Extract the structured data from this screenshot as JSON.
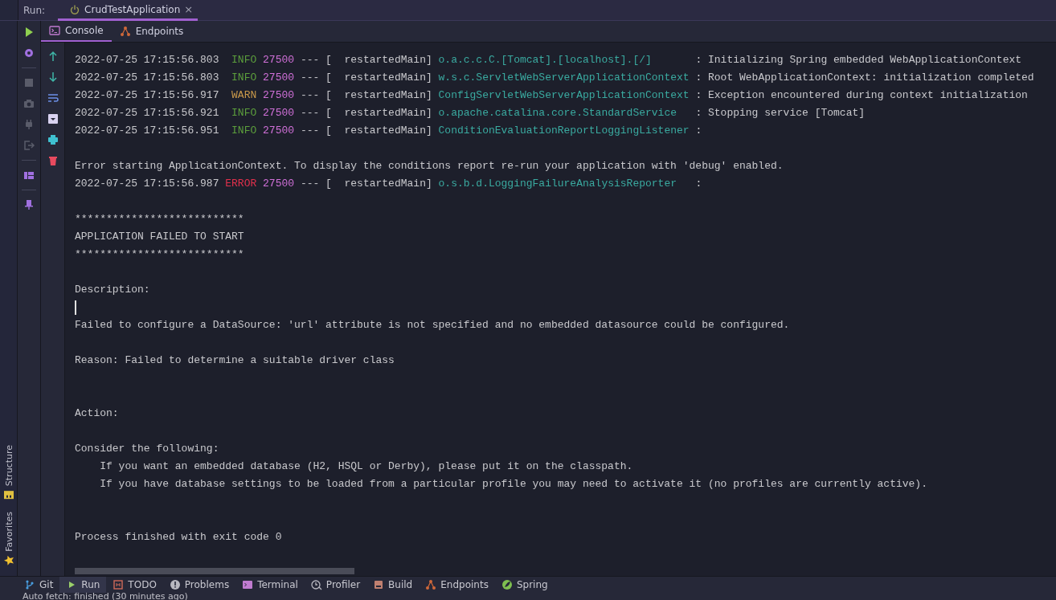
{
  "run_bar": {
    "label": "Run:",
    "tabs": [
      {
        "label": "CrudTestApplication",
        "selected": true,
        "close": "×"
      }
    ]
  },
  "console_tabs": [
    {
      "label": "Console",
      "kind": "console",
      "selected": true
    },
    {
      "label": "Endpoints",
      "kind": "endpoints",
      "selected": false
    }
  ],
  "run_toolbar": [
    {
      "kind": "run",
      "disabled": false
    },
    {
      "kind": "settings",
      "disabled": false
    },
    {
      "kind": "divider"
    },
    {
      "kind": "stop",
      "disabled": true
    },
    {
      "kind": "camera",
      "disabled": true
    },
    {
      "kind": "plug",
      "disabled": true
    },
    {
      "kind": "exit",
      "disabled": true
    },
    {
      "kind": "divider"
    },
    {
      "kind": "layout",
      "disabled": false
    },
    {
      "kind": "divider"
    },
    {
      "kind": "pin",
      "disabled": false
    }
  ],
  "console_toolbar": [
    {
      "kind": "up"
    },
    {
      "kind": "down"
    },
    {
      "kind": "wrap"
    },
    {
      "kind": "scroll-end"
    },
    {
      "kind": "print"
    },
    {
      "kind": "trash"
    }
  ],
  "side_tabs": [
    {
      "label": "Structure",
      "kind": "structure"
    },
    {
      "label": "Favorites",
      "kind": "favorites"
    }
  ],
  "console": [
    {
      "kind": "log",
      "time": "2022-07-25 17:15:56.803",
      "level": "INFO",
      "color": "#5c9e3c",
      "pid": "27500",
      "sep": "---",
      "thread": "[  restartedMain]",
      "logger": "o.a.c.c.C.[Tomcat].[localhost].[/]",
      "message": ": Initializing Spring embedded WebApplicationContext"
    },
    {
      "kind": "log",
      "time": "2022-07-25 17:15:56.803",
      "level": "INFO",
      "color": "#5c9e3c",
      "pid": "27500",
      "sep": "---",
      "thread": "[  restartedMain]",
      "logger": "w.s.c.ServletWebServerApplicationContext",
      "message": ": Root WebApplicationContext: initialization completed"
    },
    {
      "kind": "log",
      "time": "2022-07-25 17:15:56.917",
      "level": "WARN",
      "color": "#c8984a",
      "pid": "27500",
      "sep": "---",
      "thread": "[  restartedMain]",
      "logger": "ConfigServletWebServerApplicationContext",
      "message": ": Exception encountered during context initialization"
    },
    {
      "kind": "log",
      "time": "2022-07-25 17:15:56.921",
      "level": "INFO",
      "color": "#5c9e3c",
      "pid": "27500",
      "sep": "---",
      "thread": "[  restartedMain]",
      "logger": "o.apache.catalina.core.StandardService",
      "message": ": Stopping service [Tomcat]"
    },
    {
      "kind": "log",
      "time": "2022-07-25 17:15:56.951",
      "level": "INFO",
      "color": "#5c9e3c",
      "pid": "27500",
      "sep": "---",
      "thread": "[  restartedMain]",
      "logger": "ConditionEvaluationReportLoggingListener",
      "message": ":"
    },
    {
      "kind": "gap"
    },
    {
      "kind": "text",
      "text": "Error starting ApplicationContext. To display the conditions report re-run your application with 'debug' enabled."
    },
    {
      "kind": "log",
      "time": "2022-07-25 17:15:56.987",
      "level": "ERROR",
      "color": "#e0304c",
      "pid": "27500",
      "sep": "---",
      "thread": "[  restartedMain]",
      "logger": "o.s.b.d.LoggingFailureAnalysisReporter",
      "message": ":"
    },
    {
      "kind": "gap"
    },
    {
      "kind": "text",
      "text": "***************************"
    },
    {
      "kind": "text",
      "text": "APPLICATION FAILED TO START"
    },
    {
      "kind": "text",
      "text": "***************************"
    },
    {
      "kind": "gap"
    },
    {
      "kind": "text",
      "text": "Description:"
    },
    {
      "kind": "cursor"
    },
    {
      "kind": "text",
      "text": "Failed to configure a DataSource: 'url' attribute is not specified and no embedded datasource could be configured."
    },
    {
      "kind": "gap"
    },
    {
      "kind": "text",
      "text": "Reason: Failed to determine a suitable driver class"
    },
    {
      "kind": "gap"
    },
    {
      "kind": "gap"
    },
    {
      "kind": "text",
      "text": "Action:"
    },
    {
      "kind": "gap"
    },
    {
      "kind": "text",
      "text": "Consider the following:"
    },
    {
      "kind": "indented",
      "text": "If you want an embedded database (H2, HSQL or Derby), please put it on the classpath."
    },
    {
      "kind": "indented",
      "text": "If you have database settings to be loaded from a particular profile you may need to activate it (no profiles are currently active)."
    },
    {
      "kind": "gap"
    },
    {
      "kind": "gap"
    },
    {
      "kind": "text",
      "text": "Process finished with exit code 0"
    }
  ],
  "tool_windows": [
    {
      "label": "Git",
      "kind": "git",
      "selected": false
    },
    {
      "label": "Run",
      "kind": "run",
      "selected": true
    },
    {
      "label": "TODO",
      "kind": "todo",
      "selected": false
    },
    {
      "label": "Problems",
      "kind": "problems",
      "selected": false
    },
    {
      "label": "Terminal",
      "kind": "terminal",
      "selected": false
    },
    {
      "label": "Profiler",
      "kind": "profiler",
      "selected": false
    },
    {
      "label": "Build",
      "kind": "build",
      "selected": false
    },
    {
      "label": "Endpoints",
      "kind": "endpoints",
      "selected": false
    },
    {
      "label": "Spring",
      "kind": "spring",
      "selected": false
    }
  ],
  "status_bar": {
    "text": "Auto fetch: finished (30 minutes ago)"
  }
}
